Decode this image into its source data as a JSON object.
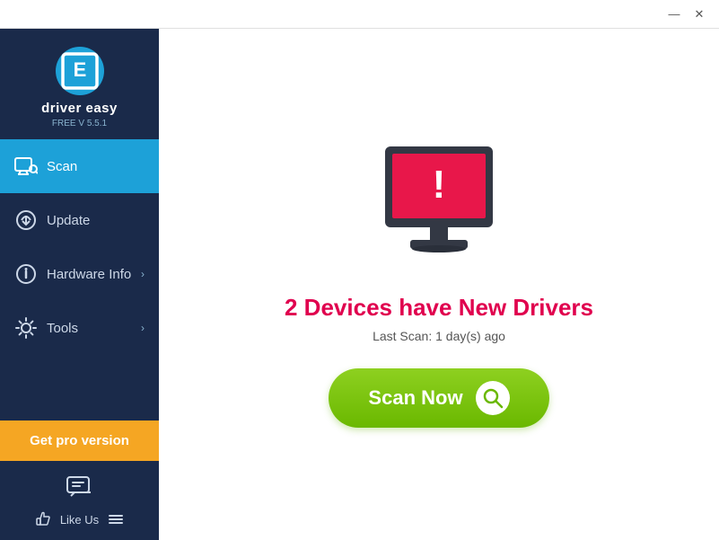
{
  "titlebar": {
    "minimize_label": "—",
    "close_label": "✕"
  },
  "sidebar": {
    "logo_text": "driver easy",
    "version": "FREE V 5.5.1",
    "nav_items": [
      {
        "id": "scan",
        "label": "Scan",
        "active": true,
        "has_chevron": false
      },
      {
        "id": "update",
        "label": "Update",
        "active": false,
        "has_chevron": false
      },
      {
        "id": "hardware-info",
        "label": "Hardware Info",
        "active": false,
        "has_chevron": true
      },
      {
        "id": "tools",
        "label": "Tools",
        "active": false,
        "has_chevron": true
      }
    ],
    "get_pro_label": "Get pro version",
    "like_us_label": "Like Us"
  },
  "content": {
    "headline": "2 Devices have New Drivers",
    "last_scan": "Last Scan: 1 day(s) ago",
    "scan_now_label": "Scan Now"
  }
}
